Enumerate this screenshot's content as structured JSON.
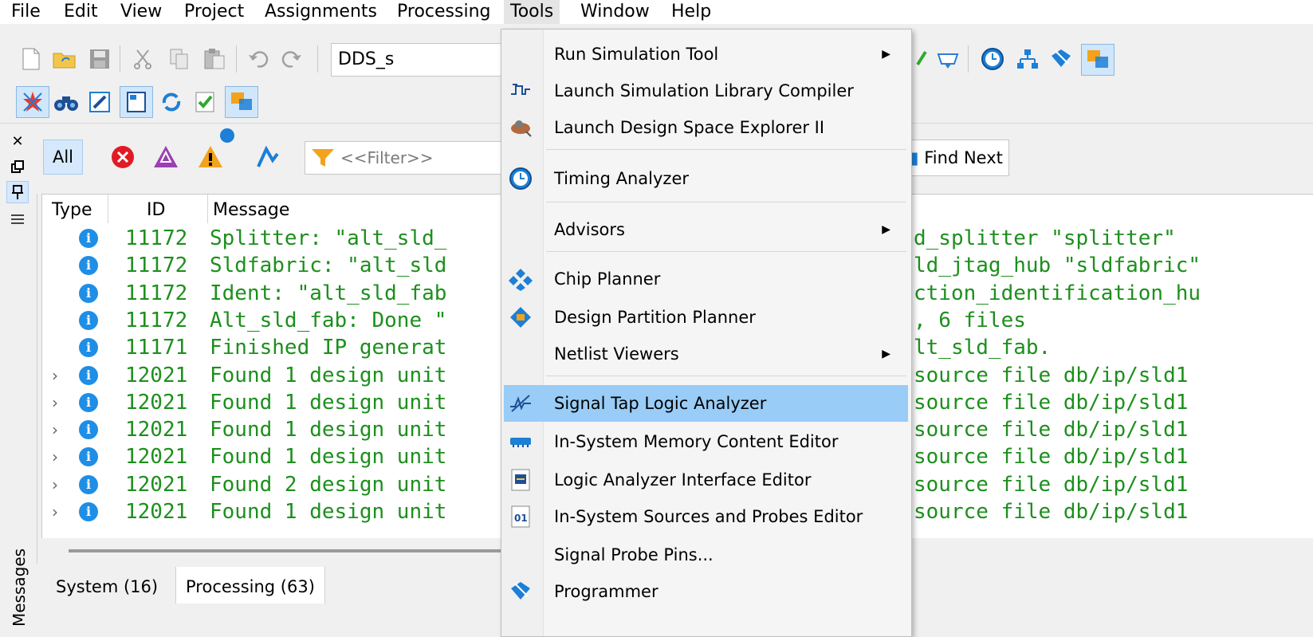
{
  "menubar": {
    "items": [
      "File",
      "Edit",
      "View",
      "Project",
      "Assignments",
      "Processing",
      "Tools",
      "Window",
      "Help"
    ]
  },
  "toolbar": {
    "project_name": "DDS_s"
  },
  "filter": {
    "all_label": "All",
    "placeholder": "<<Filter>>",
    "find_next_label": "Find Next"
  },
  "messages": {
    "columns": [
      "Type",
      "ID",
      "Message"
    ],
    "rows": [
      {
        "expandable": false,
        "id": "11172",
        "text": "Splitter: \"alt_sld_"
      },
      {
        "expandable": false,
        "id": "11172",
        "text": "Sldfabric: \"alt_sld"
      },
      {
        "expandable": false,
        "id": "11172",
        "text": "Ident: \"alt_sld_fab"
      },
      {
        "expandable": false,
        "id": "11172",
        "text": "Alt_sld_fab: Done \""
      },
      {
        "expandable": false,
        "id": "11171",
        "text": "Finished IP generat"
      },
      {
        "expandable": true,
        "id": "12021",
        "text": "Found 1 design unit"
      },
      {
        "expandable": true,
        "id": "12021",
        "text": "Found 1 design unit"
      },
      {
        "expandable": true,
        "id": "12021",
        "text": "Found 1 design unit"
      },
      {
        "expandable": true,
        "id": "12021",
        "text": "Found 1 design unit"
      },
      {
        "expandable": true,
        "id": "12021",
        "text": "Found 2 design unit"
      },
      {
        "expandable": true,
        "id": "12021",
        "text": "Found 1 design unit"
      }
    ],
    "right_fragments": [
      "d_splitter \"splitter\"",
      "ld_jtag_hub \"sldfabric\"",
      "ction_identification_hu",
      ", 6 files",
      "lt_sld_fab.",
      "source file db/ip/sld1",
      "source file db/ip/sld1",
      "source file db/ip/sld1",
      "source file db/ip/sld1",
      "source file db/ip/sld1",
      "source file db/ip/sld1"
    ]
  },
  "side_panel": {
    "label": "Messages"
  },
  "tabs": [
    {
      "label": "System (16)"
    },
    {
      "label": "Processing (63)"
    }
  ],
  "tools_menu": {
    "items": [
      {
        "label": "Run Simulation Tool",
        "submenu": true,
        "icon": "none"
      },
      {
        "label": "Launch Simulation Library Compiler",
        "submenu": false,
        "icon": "sim-library-icon"
      },
      {
        "label": "Launch Design Space Explorer II",
        "submenu": false,
        "icon": "dse-icon"
      },
      {
        "label": "Timing Analyzer",
        "submenu": false,
        "icon": "clock-icon"
      },
      {
        "label": "Advisors",
        "submenu": true,
        "icon": "none"
      },
      {
        "label": "Chip Planner",
        "submenu": false,
        "icon": "chip-planner-icon"
      },
      {
        "label": "Design Partition Planner",
        "submenu": false,
        "icon": "partition-icon"
      },
      {
        "label": "Netlist Viewers",
        "submenu": true,
        "icon": "none"
      },
      {
        "label": "Signal Tap Logic Analyzer",
        "submenu": false,
        "icon": "signal-tap-icon"
      },
      {
        "label": "In-System Memory Content Editor",
        "submenu": false,
        "icon": "memory-icon"
      },
      {
        "label": "Logic Analyzer Interface Editor",
        "submenu": false,
        "icon": "lai-icon"
      },
      {
        "label": "In-System Sources and Probes Editor",
        "submenu": false,
        "icon": "probes-icon"
      },
      {
        "label": "Signal Probe Pins...",
        "submenu": false,
        "icon": "none"
      },
      {
        "label": "Programmer",
        "submenu": false,
        "icon": "programmer-icon"
      }
    ],
    "highlighted": "Signal Tap Logic Analyzer"
  }
}
